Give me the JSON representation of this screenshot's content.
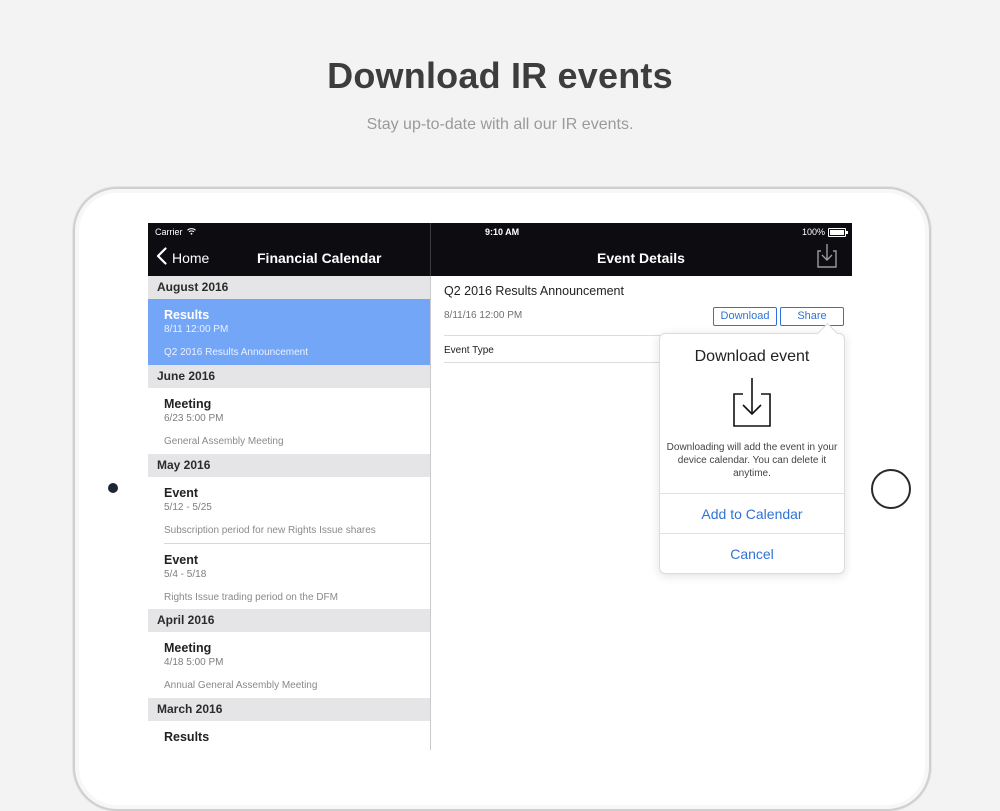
{
  "promo": {
    "title": "Download IR events",
    "subtitle": "Stay up-to-date with all our IR events."
  },
  "status_bar": {
    "carrier": "Carrier",
    "time": "9:10 AM",
    "battery": "100%"
  },
  "nav": {
    "back_label": "Home",
    "left_title": "Financial Calendar",
    "right_title": "Event Details"
  },
  "list": {
    "sections": [
      {
        "header": "August 2016",
        "items": [
          {
            "title": "Results",
            "date": "8/11 12:00 PM",
            "description": "Q2 2016 Results Announcement",
            "selected": true
          }
        ]
      },
      {
        "header": "June 2016",
        "items": [
          {
            "title": "Meeting",
            "date": "6/23 5:00 PM",
            "description": "General Assembly Meeting"
          }
        ]
      },
      {
        "header": "May 2016",
        "items": [
          {
            "title": "Event",
            "date": "5/12 - 5/25",
            "description": "Subscription period for new Rights Issue shares"
          },
          {
            "title": "Event",
            "date": "5/4 - 5/18",
            "description": "Rights Issue trading period on the DFM"
          }
        ]
      },
      {
        "header": "April 2016",
        "items": [
          {
            "title": "Meeting",
            "date": "4/18 5:00 PM",
            "description": "Annual General Assembly Meeting"
          }
        ]
      },
      {
        "header": "March 2016",
        "items": [
          {
            "title": "Results",
            "date": "",
            "description": ""
          }
        ]
      }
    ]
  },
  "detail": {
    "title": "Q2 2016 Results Announcement",
    "date": "8/11/16 12:00 PM",
    "download_label": "Download",
    "share_label": "Share",
    "event_type_label": "Event Type"
  },
  "popover": {
    "title": "Download event",
    "text": "Downloading will add the event in your device calendar. You can delete it anytime.",
    "add_label": "Add to Calendar",
    "cancel_label": "Cancel"
  },
  "colors": {
    "accent": "#2f73d6",
    "selected_row": "#74a6f8",
    "nav_bar": "#0c0c11"
  }
}
